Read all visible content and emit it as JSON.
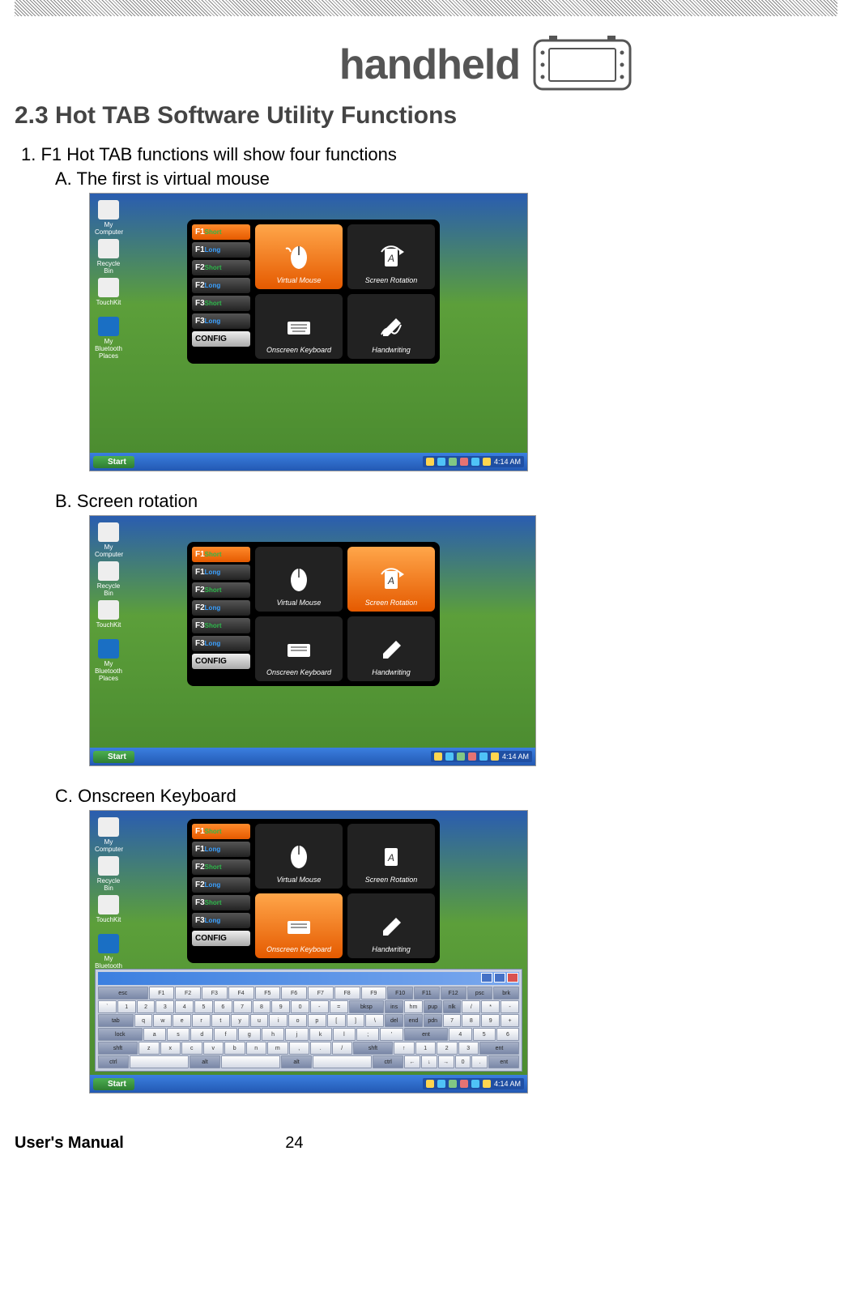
{
  "logo": "handheld",
  "section_title": "2.3 Hot TAB Software Utility Functions",
  "list": {
    "n1": "1.  F1 Hot TAB functions will show four functions",
    "a": "A.  The first is virtual mouse",
    "b": "B.  Screen rotation",
    "c": "C.  Onscreen Keyboard"
  },
  "footer": {
    "left": "User's Manual",
    "page": "24"
  },
  "shot": {
    "desktop_icons": [
      "My Computer",
      "Recycle Bin",
      "TouchKit",
      "My Bluetooth Places"
    ],
    "start": "Start",
    "clock": "4:14 AM",
    "fkeys": [
      {
        "k": "F1",
        "t": "Short"
      },
      {
        "k": "F1",
        "t": "Long"
      },
      {
        "k": "F2",
        "t": "Short"
      },
      {
        "k": "F2",
        "t": "Long"
      },
      {
        "k": "F3",
        "t": "Short"
      },
      {
        "k": "F3",
        "t": "Long"
      }
    ],
    "config": "CONFIG",
    "tiles": {
      "virtual_mouse": "Virtual Mouse",
      "screen_rotation": "Screen Rotation",
      "onscreen_keyboard": "Onscreen Keyboard",
      "handwriting": "Handwriting"
    }
  },
  "keyboard_rows": [
    [
      "esc",
      "F1",
      "F2",
      "F3",
      "F4",
      "F5",
      "F6",
      "F7",
      "F8",
      "F9",
      "F10",
      "F11",
      "F12",
      "psc",
      "brk"
    ],
    [
      "`",
      "1",
      "2",
      "3",
      "4",
      "5",
      "6",
      "7",
      "8",
      "9",
      "0",
      "-",
      "=",
      "bksp",
      "ins",
      "hm",
      "pup",
      "nlk",
      "/",
      "*",
      "-"
    ],
    [
      "tab",
      "q",
      "w",
      "e",
      "r",
      "t",
      "y",
      "u",
      "i",
      "o",
      "p",
      "[",
      "]",
      "\\",
      "del",
      "end",
      "pdn",
      "7",
      "8",
      "9",
      "+"
    ],
    [
      "lock",
      "a",
      "s",
      "d",
      "f",
      "g",
      "h",
      "j",
      "k",
      "l",
      ";",
      "'",
      "ent",
      "4",
      "5",
      "6"
    ],
    [
      "shft",
      "z",
      "x",
      "c",
      "v",
      "b",
      "n",
      "m",
      ",",
      ".",
      "/",
      "shft",
      "↑",
      "1",
      "2",
      "3",
      "ent"
    ],
    [
      "ctrl",
      "",
      "alt",
      "",
      "alt",
      "",
      "ctrl",
      "←",
      "↓",
      "→",
      "0",
      ".",
      "ent"
    ]
  ]
}
